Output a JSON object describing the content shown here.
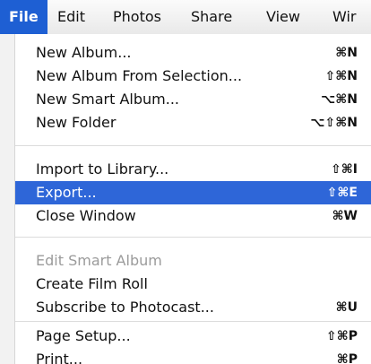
{
  "menubar": {
    "items": [
      {
        "label": "File"
      },
      {
        "label": "Edit"
      },
      {
        "label": "Photos"
      },
      {
        "label": "Share"
      },
      {
        "label": "View"
      },
      {
        "label": "Wir"
      }
    ]
  },
  "menu": {
    "items": [
      {
        "label": "New Album...",
        "shortcut": "⌘N"
      },
      {
        "label": "New Album From Selection...",
        "shortcut": "⇧⌘N"
      },
      {
        "label": "New Smart Album...",
        "shortcut": "⌥⌘N"
      },
      {
        "label": "New Folder",
        "shortcut": "⌥⇧⌘N"
      },
      {
        "label": "Import to Library...",
        "shortcut": "⇧⌘I"
      },
      {
        "label": "Export...",
        "shortcut": "⇧⌘E"
      },
      {
        "label": "Close Window",
        "shortcut": "⌘W"
      },
      {
        "label": "Edit Smart Album",
        "shortcut": ""
      },
      {
        "label": "Create Film Roll",
        "shortcut": ""
      },
      {
        "label": "Subscribe to Photocast...",
        "shortcut": "⌘U"
      },
      {
        "label": "Page Setup...",
        "shortcut": "⇧⌘P"
      },
      {
        "label": "Print...",
        "shortcut": "⌘P"
      }
    ]
  }
}
